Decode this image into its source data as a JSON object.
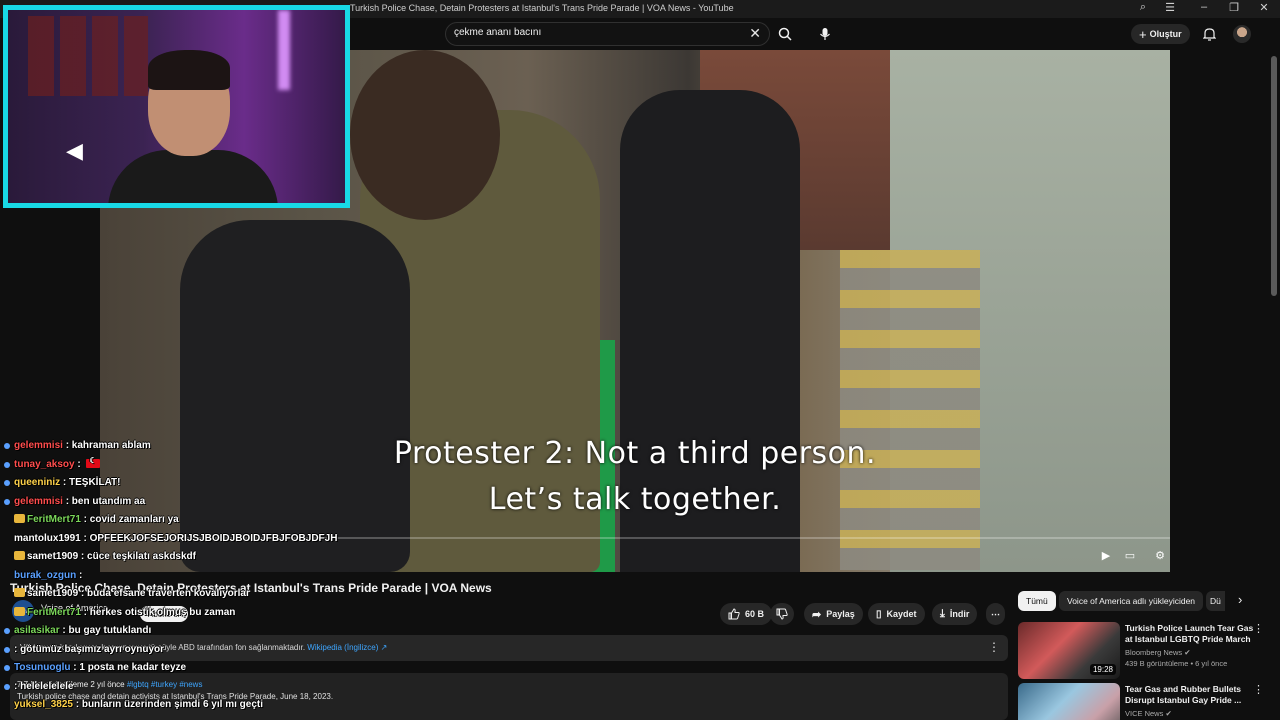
{
  "window": {
    "title": "Turkish Police Chase, Detain Protesters at Istanbul's Trans Pride Parade | VOA News - YouTube"
  },
  "header": {
    "search_value": "çekme ananı bacını",
    "search_clear": "✕",
    "create_label": "Oluştur"
  },
  "video": {
    "subtitle_line1": "Protester 2: Not a third person.",
    "subtitle_line2": "Let’s talk together.",
    "title": "Turkish Police Chase, Detain Protesters at Istanbul's Trans Pride Parade | VOA News",
    "progress": 0.0
  },
  "channel": {
    "name": "Voice of America",
    "avatar_text": "VOA",
    "subscribe_label": "Abone ol"
  },
  "actions": {
    "like_count": "60 B",
    "share_label": "Paylaş",
    "save_label": "Kaydet",
    "download_label": "İndir"
  },
  "info_panel": {
    "text": "VOA yayın kuruluşuna kısmen veya tümüyle ABD tarafından fon sağlanmaktadır.",
    "link": "Wikipedia (İngilizce) ↗"
  },
  "description": {
    "views_date": "7,7 Mn görüntüleme  2 yıl önce",
    "tags": "#lgbtq #turkey #news",
    "body": "Turkish police chase and detain activists at Istanbul's Trans Pride Parade, June 18, 2023."
  },
  "sidebar": {
    "chips": [
      "Tümü",
      "Voice of America adlı yükleyiciden",
      "Dü"
    ],
    "recommendations": [
      {
        "title": "Turkish Police Launch Tear Gas at Istanbul LGBTQ Pride March",
        "channel": "Bloomberg News",
        "views": "439 B görüntüleme • 6 yıl önce",
        "duration": "19:28"
      },
      {
        "title": "Tear Gas and Rubber Bullets Disrupt Istanbul Gay Pride ...",
        "channel": "VICE News",
        "views": "",
        "duration": ""
      }
    ]
  },
  "chat": [
    {
      "user": "gelemmisi",
      "msg": "kahraman ablam",
      "color": "#ff4d4d",
      "dot": "#5aa0ff"
    },
    {
      "user": "tunay_aksoy",
      "msg": "",
      "color": "#ff4d4d",
      "dot": "#5aa0ff",
      "flag": true
    },
    {
      "user": "queeniniz",
      "msg": "TEŞKİLAT!",
      "color": "#ffd24a",
      "dot": "#5aa0ff"
    },
    {
      "user": "gelemmisi",
      "msg": "ben utandım aa",
      "color": "#ff4d4d",
      "dot": "#5aa0ff"
    },
    {
      "user": "FeritMert71",
      "msg": "covid zamanları ya",
      "color": "#7bd65a",
      "dot": "",
      "emo": true
    },
    {
      "user": "mantolux1991",
      "msg": "OPFEEKJOFSEJORIJSJBOIDJBOIDJFBJFOBJDFJH",
      "color": "#ffffff",
      "dot": ""
    },
    {
      "user": "samet1909",
      "msg": "cüce teşkilatı askdskdf",
      "color": "#ffffff",
      "dot": "",
      "emo": true
    },
    {
      "user": "burak_ozgun",
      "msg": "",
      "color": "#5aa0ff",
      "dot": ""
    },
    {
      "user": "samet1909",
      "msg": "buda efsane traverten kovalıyorlar",
      "color": "#ffffff",
      "dot": "",
      "emo": true
    },
    {
      "user": "FeritMert71",
      "msg": "herkes otistik olmuş bu zaman",
      "color": "#7bd65a",
      "dot": "",
      "emo": true
    },
    {
      "user": "asilasikar",
      "msg": "bu gay tutuklandı",
      "color": "#7bd65a",
      "dot": "#5aa0ff"
    },
    {
      "user": "",
      "msg": "götümüz başımız ayrı oynuyor",
      "color": "#ff4d4d",
      "dot": "#5aa0ff"
    },
    {
      "user": "Tosunuoglu",
      "msg": "1 posta ne kadar teyze",
      "color": "#5aa0ff",
      "dot": "#5aa0ff"
    },
    {
      "user": "",
      "msg": "helelelelele",
      "color": "#5aa0ff",
      "dot": "#5aa0ff"
    },
    {
      "user": "yuksel_3825",
      "msg": "bunların üzerinden şimdi 6 yıl mı geçti",
      "color": "#ffd24a",
      "dot": ""
    }
  ]
}
